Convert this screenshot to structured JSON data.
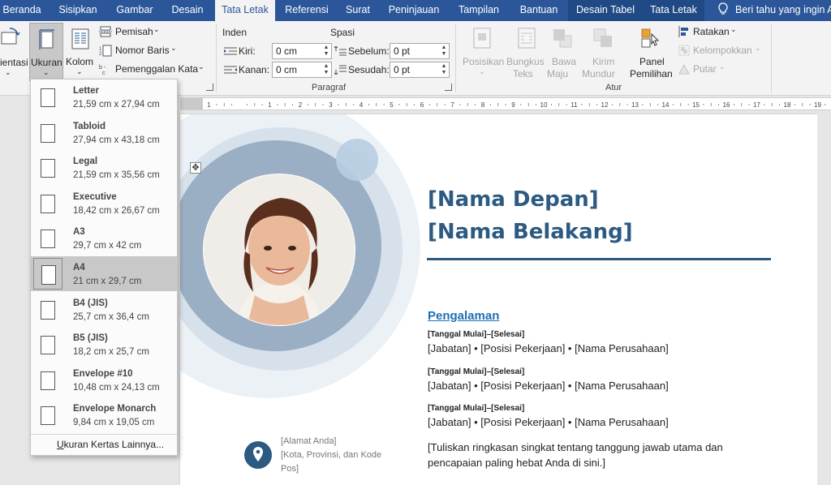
{
  "tabs": [
    "Beranda",
    "Sisipkan",
    "Gambar",
    "Desain",
    "Tata Letak",
    "Referensi",
    "Surat",
    "Peninjauan",
    "Tampilan",
    "Bantuan",
    "Desain Tabel",
    "Tata Letak"
  ],
  "tell_me": "Beri tahu yang ingin A",
  "ribbon": {
    "orientasi": "ientasi",
    "ukuran": "Ukuran",
    "kolom": "Kolom",
    "pemisah": "Pemisah",
    "nomor_baris": "Nomor Baris",
    "pemenggalan": "Pemenggalan Kata",
    "inden": "Inden",
    "kiri_label": "Kiri:",
    "kiri_value": "0 cm",
    "kanan_label": "Kanan:",
    "kanan_value": "0 cm",
    "spasi": "Spasi",
    "sebelum_label": "Sebelum:",
    "sebelum_value": "0 pt",
    "sesudah_label": "Sesudah:",
    "sesudah_value": "0 pt",
    "paragraf": "Paragraf",
    "posisikan": "Posisikan",
    "bungkus_1": "Bungkus",
    "bungkus_2": "Teks",
    "bawa_1": "Bawa",
    "bawa_2": "Maju",
    "kirim_1": "Kirim",
    "kirim_2": "Mundur",
    "panel_1": "Panel",
    "panel_2": "Pemilihan",
    "ratakan": "Ratakan",
    "kelompokkan": "Kelompokkan",
    "putar": "Putar",
    "atur": "Atur"
  },
  "ruler_numbers": [
    "2",
    "1",
    "1",
    "2",
    "3",
    "4",
    "5",
    "6",
    "7",
    "8",
    "9",
    "10",
    "11",
    "12",
    "13",
    "14",
    "15",
    "16",
    "17",
    "18",
    "19",
    "20"
  ],
  "paper_sizes": [
    {
      "name": "Letter",
      "size": "21,59 cm x 27,94 cm"
    },
    {
      "name": "Tabloid",
      "size": "27,94 cm x 43,18 cm"
    },
    {
      "name": "Legal",
      "size": "21,59 cm x 35,56 cm"
    },
    {
      "name": "Executive",
      "size": "18,42 cm x 26,67 cm"
    },
    {
      "name": "A3",
      "size": "29,7 cm x 42 cm"
    },
    {
      "name": "A4",
      "size": "21 cm x 29,7 cm"
    },
    {
      "name": "B4 (JIS)",
      "size": "25,7 cm x 36,4 cm"
    },
    {
      "name": "B5 (JIS)",
      "size": "18,2 cm x 25,7 cm"
    },
    {
      "name": "Envelope #10",
      "size": "10,48 cm x 24,13 cm"
    },
    {
      "name": "Envelope Monarch",
      "size": "9,84 cm x 19,05 cm"
    }
  ],
  "selected_paper": "A4",
  "more_sizes_accel": "U",
  "more_sizes_rest": "kuran Kertas Lainnya...",
  "document": {
    "first_name": "[Nama Depan]",
    "last_name": "[Nama Belakang]",
    "section": "Pengalaman",
    "experience": [
      {
        "date": "[Tanggal Mulai]–[Selesai]",
        "job": "[Jabatan] • [Posisi Pekerjaan] • [Nama Perusahaan]"
      },
      {
        "date": "[Tanggal Mulai]–[Selesai]",
        "job": "[Jabatan] • [Posisi Pekerjaan] • [Nama Perusahaan]"
      },
      {
        "date": "[Tanggal Mulai]–[Selesai]",
        "job": "[Jabatan] • [Posisi Pekerjaan] • [Nama Perusahaan]"
      }
    ],
    "summary": "[Tuliskan ringkasan singkat tentang tanggung jawab utama dan pencapaian paling hebat Anda di sini.]",
    "address_1": "[Alamat Anda]",
    "address_2": "[Kota, Provinsi, dan Kode",
    "address_3": "Pos]"
  },
  "colors": {
    "title_bar": "#2b579a",
    "context_tab": "#1f4a86",
    "name_text": "#2d5a82",
    "section_link": "#1f6fb4",
    "photo_ring": "#9aaec4",
    "selected_item": "#c8c8c8"
  },
  "icons": [
    "lightbulb-icon",
    "orientation-icon",
    "size-icon",
    "columns-icon",
    "breaks-icon",
    "line-numbers-icon",
    "hyphenation-icon",
    "indent-left-icon",
    "indent-right-icon",
    "spacing-before-icon",
    "spacing-after-icon",
    "position-icon",
    "wrap-text-icon",
    "bring-forward-icon",
    "send-backward-icon",
    "selection-pane-icon",
    "align-icon",
    "group-icon",
    "rotate-icon",
    "move-handle-icon",
    "location-pin-icon"
  ]
}
